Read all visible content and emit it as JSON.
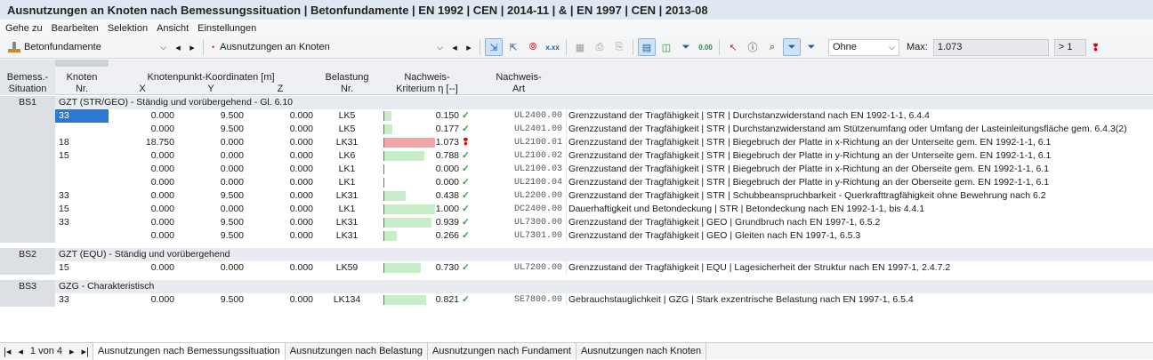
{
  "window": {
    "title": "Ausnutzungen an Knoten nach Bemessungssituation | Betonfundamente | EN 1992 | CEN | 2014-11 | & | EN 1997 | CEN | 2013-08"
  },
  "menu": [
    "Gehe zu",
    "Bearbeiten",
    "Selektion",
    "Ansicht",
    "Einstellungen"
  ],
  "toolbar": {
    "module": "Betonfundamente",
    "result_type": "Ausnutzungen an Knoten",
    "filter": "Ohne",
    "max_label": "Max:",
    "max_value": "1.073",
    "gt1": "> 1"
  },
  "headers": {
    "sit1": "Bemess.-",
    "sit2": "Situation",
    "node1": "Knoten",
    "node2": "Nr.",
    "coords": "Knotenpunkt-Koordinaten [m]",
    "x": "X",
    "y": "Y",
    "z": "Z",
    "load1": "Belastung",
    "load2": "Nr.",
    "crit1": "Nachweis-",
    "crit2": "Kriterium η [--]",
    "type1": "Nachweis-",
    "type2": "Art"
  },
  "groups": [
    {
      "id": "BS1",
      "title": "GZT (STR/GEO) - Ständig und vorübergehend - Gl. 6.10",
      "rows": [
        {
          "node": "33",
          "x": "0.000",
          "y": "9.500",
          "z": "0.000",
          "load": "LK5",
          "eta": "0.150",
          "ratio": 0.15,
          "status": "ok",
          "code": "UL2400.00",
          "desc": "Grenzzustand der Tragfähigkeit | STR | Durchstanzwiderstand nach EN 1992-1-1, 6.4.4"
        },
        {
          "node": "",
          "x": "0.000",
          "y": "9.500",
          "z": "0.000",
          "load": "LK5",
          "eta": "0.177",
          "ratio": 0.177,
          "status": "ok",
          "code": "UL2401.00",
          "desc": "Grenzzustand der Tragfähigkeit | STR | Durchstanzwiderstand am Stützenumfang oder Umfang der Lasteinleitungsfläche gem. 6.4.3(2)"
        },
        {
          "node": "18",
          "x": "18.750",
          "y": "0.000",
          "z": "0.000",
          "load": "LK31",
          "eta": "1.073",
          "ratio": 1.073,
          "status": "bad",
          "code": "UL2100.01",
          "desc": "Grenzzustand der Tragfähigkeit | STR | Biegebruch der Platte in x-Richtung an der Unterseite gem. EN 1992-1-1, 6.1"
        },
        {
          "node": "15",
          "x": "0.000",
          "y": "0.000",
          "z": "0.000",
          "load": "LK6",
          "eta": "0.788",
          "ratio": 0.788,
          "status": "ok",
          "code": "UL2100.02",
          "desc": "Grenzzustand der Tragfähigkeit | STR | Biegebruch der Platte in y-Richtung an der Unterseite gem. EN 1992-1-1, 6.1"
        },
        {
          "node": "",
          "x": "0.000",
          "y": "0.000",
          "z": "0.000",
          "load": "LK1",
          "eta": "0.000",
          "ratio": 0,
          "status": "ok",
          "code": "UL2100.03",
          "desc": "Grenzzustand der Tragfähigkeit | STR | Biegebruch der Platte in x-Richtung an der Oberseite gem. EN 1992-1-1, 6.1"
        },
        {
          "node": "",
          "x": "0.000",
          "y": "0.000",
          "z": "0.000",
          "load": "LK1",
          "eta": "0.000",
          "ratio": 0,
          "status": "ok",
          "code": "UL2100.04",
          "desc": "Grenzzustand der Tragfähigkeit | STR | Biegebruch der Platte in y-Richtung an der Oberseite gem. EN 1992-1-1, 6.1"
        },
        {
          "node": "33",
          "x": "0.000",
          "y": "9.500",
          "z": "0.000",
          "load": "LK31",
          "eta": "0.438",
          "ratio": 0.438,
          "status": "ok",
          "code": "UL2200.00",
          "desc": "Grenzzustand der Tragfähigkeit | STR | Schubbeanspruchbarkeit - Querkrafttragfähigkeit ohne Bewehrung nach 6.2"
        },
        {
          "node": "15",
          "x": "0.000",
          "y": "0.000",
          "z": "0.000",
          "load": "LK1",
          "eta": "1.000",
          "ratio": 1.0,
          "status": "ok",
          "code": "DC2400.00",
          "desc": "Dauerhaftigkeit und Betondeckung | STR | Betondeckung nach EN 1992-1-1, bis 4.4.1"
        },
        {
          "node": "33",
          "x": "0.000",
          "y": "9.500",
          "z": "0.000",
          "load": "LK31",
          "eta": "0.939",
          "ratio": 0.939,
          "status": "ok",
          "code": "UL7300.00",
          "desc": "Grenzzustand der Tragfähigkeit | GEO | Grundbruch nach EN 1997-1, 6.5.2"
        },
        {
          "node": "",
          "x": "0.000",
          "y": "9.500",
          "z": "0.000",
          "load": "LK31",
          "eta": "0.266",
          "ratio": 0.266,
          "status": "ok",
          "code": "UL7301.00",
          "desc": "Grenzzustand der Tragfähigkeit | GEO | Gleiten nach EN 1997-1, 6.5.3"
        }
      ]
    },
    {
      "id": "BS2",
      "title": "GZT (EQU) - Ständig und vorübergehend",
      "rows": [
        {
          "node": "15",
          "x": "0.000",
          "y": "0.000",
          "z": "0.000",
          "load": "LK59",
          "eta": "0.730",
          "ratio": 0.73,
          "status": "ok",
          "code": "UL7200.00",
          "desc": "Grenzzustand der Tragfähigkeit | EQU | Lagesicherheit der Struktur nach EN 1997-1, 2.4.7.2"
        }
      ]
    },
    {
      "id": "BS3",
      "title": "GZG - Charakteristisch",
      "rows": [
        {
          "node": "33",
          "x": "0.000",
          "y": "9.500",
          "z": "0.000",
          "load": "LK134",
          "eta": "0.821",
          "ratio": 0.821,
          "status": "ok",
          "code": "SE7800.00",
          "desc": "Gebrauchstauglichkeit | GZG | Stark exzentrische Belastung nach EN 1997-1, 6.5.4"
        }
      ]
    }
  ],
  "pager": {
    "text": "1 von 4"
  },
  "tabs": [
    "Ausnutzungen nach Bemessungssituation",
    "Ausnutzungen nach Belastung",
    "Ausnutzungen nach Fundament",
    "Ausnutzungen nach Knoten"
  ]
}
